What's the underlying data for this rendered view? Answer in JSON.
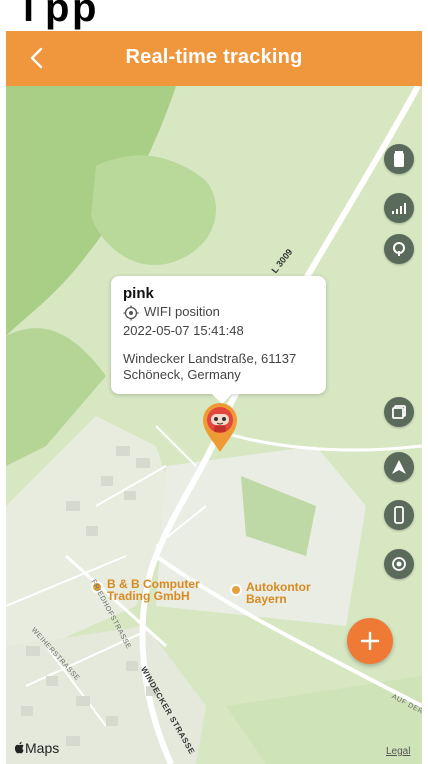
{
  "header": {
    "title": "Real-time tracking",
    "back_icon": "chevron-left-icon"
  },
  "popup": {
    "device_name": "pink",
    "position_type": "WIFI position",
    "timestamp": "2022-05-07 15:41:48",
    "address": "Windecker Landstraße, 61137 Schöneck, Germany"
  },
  "controls": {
    "battery": "battery-icon",
    "signal": "signal-icon",
    "satellite": "satellite-icon",
    "layers": "layers-icon",
    "navigate": "navigation-arrow-icon",
    "device": "phone-icon",
    "locate": "target-icon"
  },
  "map": {
    "road_l3009": "L 3009",
    "poi_1": "B & B Computer Trading GmbH",
    "poi_2": "Autokontor Bayern",
    "street_friedhof": "FRIEDHOFSTRASSE",
    "street_weiher": "WEIHERSTRASSE",
    "street_windecker": "WINDECKER STRASSE",
    "street_aufder": "AUF DER",
    "maps_logo": "Maps",
    "legal": "Legal"
  },
  "fab": {
    "icon": "plus-icon"
  },
  "colors": {
    "header": "#f0963d",
    "fab": "#ef7a35",
    "control": "#5b6b5b"
  }
}
